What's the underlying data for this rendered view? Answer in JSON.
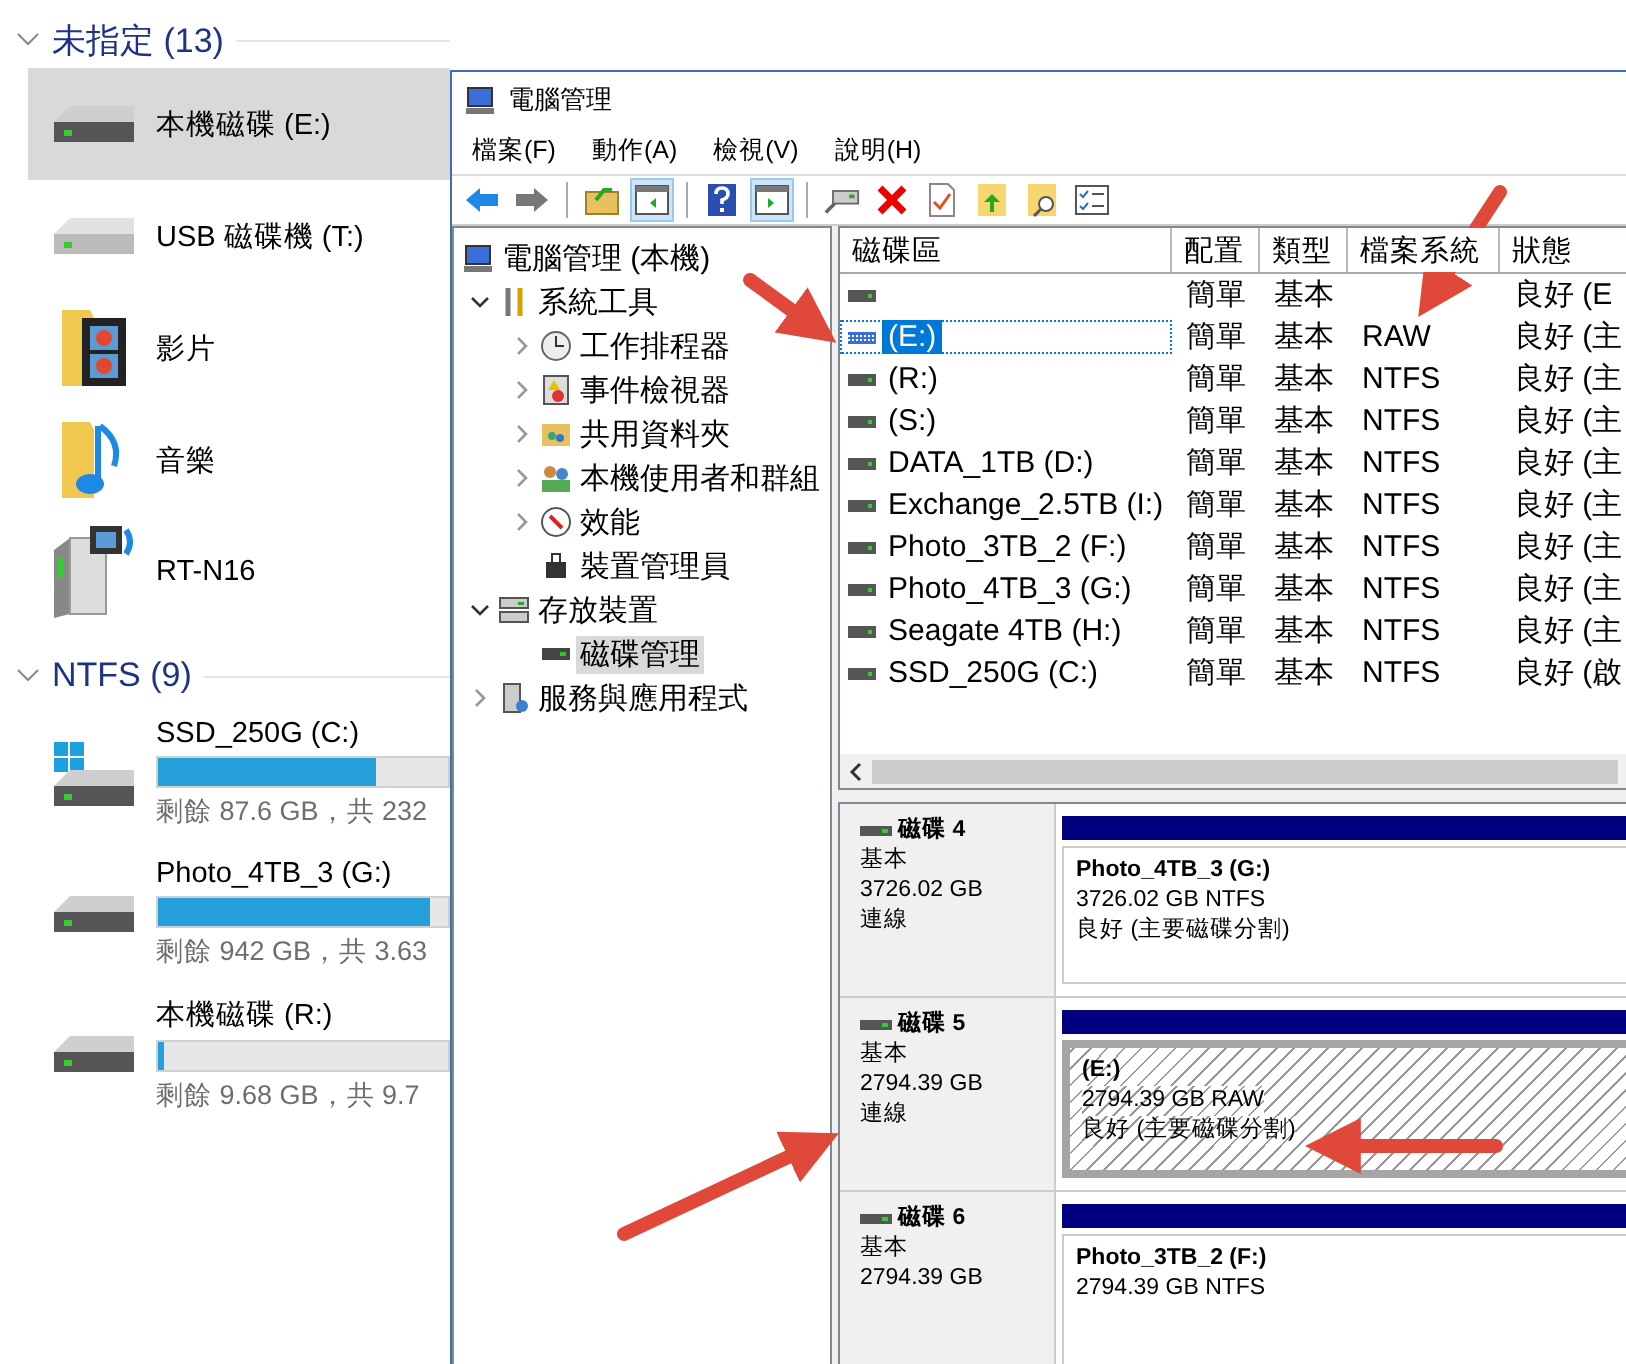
{
  "explorer": {
    "groups": [
      {
        "title": "未指定 (13)",
        "items": [
          {
            "kind": "drive",
            "name": "本機磁碟 (E:)",
            "selected": true
          },
          {
            "kind": "usb-drive",
            "name": "USB 磁碟機 (T:)",
            "selected": false
          },
          {
            "kind": "videos-folder",
            "name": "影片",
            "selected": false
          },
          {
            "kind": "music-folder",
            "name": "音樂",
            "selected": false
          },
          {
            "kind": "media-device",
            "name": "RT-N16",
            "selected": false
          }
        ]
      },
      {
        "title": "NTFS (9)",
        "items": [
          {
            "kind": "windows-drive",
            "name": "SSD_250G (C:)",
            "selected": false,
            "level": 0.75,
            "free": "剩餘 87.6 GB，共 232"
          },
          {
            "kind": "drive",
            "name": "Photo_4TB_3 (G:)",
            "selected": false,
            "level": 0.94,
            "free": "剩餘 942 GB，共 3.63"
          },
          {
            "kind": "drive",
            "name": "本機磁碟 (R:)",
            "selected": false,
            "level": 0.02,
            "free": "剩餘 9.68 GB，共 9.7"
          }
        ]
      }
    ]
  },
  "window": {
    "title": "電腦管理",
    "menu": [
      "檔案(F)",
      "動作(A)",
      "檢視(V)",
      "說明(H)"
    ],
    "toolbar": [
      [
        {
          "kind": "back",
          "pressed": false
        },
        {
          "kind": "forward",
          "pressed": false
        }
      ],
      [
        {
          "kind": "up-folder",
          "pressed": false
        },
        {
          "kind": "left-pane",
          "pressed": true
        }
      ],
      [
        {
          "kind": "help",
          "pressed": false
        },
        {
          "kind": "right-pane",
          "pressed": true
        }
      ],
      [
        {
          "kind": "connect",
          "pressed": false
        },
        {
          "kind": "delete",
          "pressed": false
        },
        {
          "kind": "properties",
          "pressed": false
        },
        {
          "kind": "export",
          "pressed": false
        },
        {
          "kind": "search",
          "pressed": false
        },
        {
          "kind": "checklist",
          "pressed": false
        }
      ]
    ],
    "tree": [
      {
        "label": "電腦管理 (本機)",
        "kind": "computer",
        "selected": false,
        "children": [
          {
            "label": "系統工具",
            "kind": "tools",
            "expanded": true,
            "selected": false,
            "children": [
              {
                "label": "工作排程器",
                "kind": "scheduler",
                "expanded": false,
                "selected": false
              },
              {
                "label": "事件檢視器",
                "kind": "event-viewer",
                "expanded": false,
                "selected": false
              },
              {
                "label": "共用資料夾",
                "kind": "shared-folders",
                "expanded": false,
                "selected": false
              },
              {
                "label": "本機使用者和群組",
                "kind": "users",
                "expanded": false,
                "selected": false
              },
              {
                "label": "效能",
                "kind": "performance",
                "expanded": false,
                "selected": false
              },
              {
                "label": "裝置管理員",
                "kind": "device-manager",
                "selected": false
              }
            ]
          },
          {
            "label": "存放裝置",
            "kind": "storage",
            "expanded": true,
            "selected": false,
            "children": [
              {
                "label": "磁碟管理",
                "kind": "disk-management",
                "selected": true
              }
            ]
          },
          {
            "label": "服務與應用程式",
            "kind": "services",
            "expanded": false,
            "selected": false
          }
        ]
      }
    ],
    "volumes": {
      "columns": [
        "磁碟區",
        "配置",
        "類型",
        "檔案系統",
        "狀態"
      ],
      "rows": [
        {
          "kind": "basic",
          "cells": [
            "",
            "簡單",
            "基本",
            "",
            "良好 (E"
          ],
          "selected": false
        },
        {
          "kind": "unformatted",
          "cells": [
            "(E:)",
            "簡單",
            "基本",
            "RAW",
            "良好 (主"
          ],
          "selected": true
        },
        {
          "kind": "basic",
          "cells": [
            "(R:)",
            "簡單",
            "基本",
            "NTFS",
            "良好 (主"
          ],
          "selected": false
        },
        {
          "kind": "basic",
          "cells": [
            "(S:)",
            "簡單",
            "基本",
            "NTFS",
            "良好 (主"
          ],
          "selected": false
        },
        {
          "kind": "basic",
          "cells": [
            "DATA_1TB (D:)",
            "簡單",
            "基本",
            "NTFS",
            "良好 (主"
          ],
          "selected": false
        },
        {
          "kind": "basic",
          "cells": [
            "Exchange_2.5TB (I:)",
            "簡單",
            "基本",
            "NTFS",
            "良好 (主"
          ],
          "selected": false
        },
        {
          "kind": "basic",
          "cells": [
            "Photo_3TB_2 (F:)",
            "簡單",
            "基本",
            "NTFS",
            "良好 (主"
          ],
          "selected": false
        },
        {
          "kind": "basic",
          "cells": [
            "Photo_4TB_3 (G:)",
            "簡單",
            "基本",
            "NTFS",
            "良好 (主"
          ],
          "selected": false
        },
        {
          "kind": "basic",
          "cells": [
            "Seagate 4TB (H:)",
            "簡單",
            "基本",
            "NTFS",
            "良好 (主"
          ],
          "selected": false
        },
        {
          "kind": "basic",
          "cells": [
            "SSD_250G (C:)",
            "簡單",
            "基本",
            "NTFS",
            "良好 (啟"
          ],
          "selected": false
        }
      ]
    },
    "disks": [
      {
        "name": "磁碟 4",
        "type": "基本",
        "size": "3726.02 GB",
        "status": "連線",
        "partition": {
          "kind": "ntfs",
          "selected": false,
          "lines": [
            "Photo_4TB_3  (G:)",
            "3726.02 GB NTFS",
            "良好 (主要磁碟分割)"
          ]
        }
      },
      {
        "name": "磁碟 5",
        "type": "基本",
        "size": "2794.39 GB",
        "status": "連線",
        "partition": {
          "kind": "raw",
          "selected": true,
          "lines": [
            "(E:)",
            "2794.39 GB RAW",
            "良好 (主要磁碟分割)"
          ]
        }
      },
      {
        "name": "磁碟 6",
        "type": "基本",
        "size": "2794.39 GB",
        "partition": {
          "kind": "ntfs",
          "selected": false,
          "lines": [
            "Photo_3TB_2  (F:)",
            "2794.39 GB NTFS"
          ]
        }
      }
    ]
  }
}
